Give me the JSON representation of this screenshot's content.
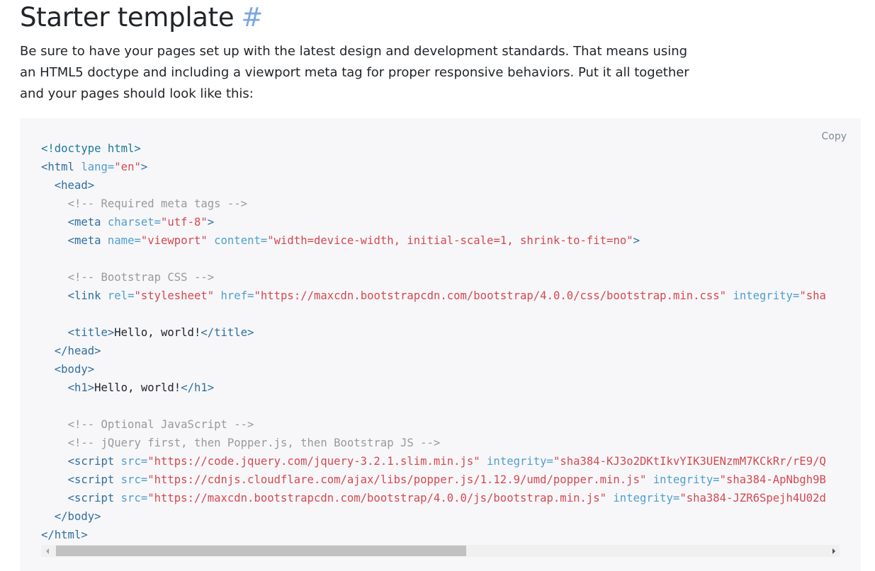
{
  "section": {
    "title": "Starter template",
    "anchor": "#",
    "lead": "Be sure to have your pages set up with the latest design and development standards. That means using an HTML5 doctype and including a viewport meta tag for proper responsive behaviors. Put it all together and your pages should look like this:"
  },
  "code_block": {
    "copy_label": "Copy",
    "lines": [
      [
        {
          "t": "dt",
          "s": "<!doctype html>"
        }
      ],
      [
        {
          "t": "tag",
          "s": "<html "
        },
        {
          "t": "attr",
          "s": "lang="
        },
        {
          "t": "str",
          "s": "\"en\""
        },
        {
          "t": "tag",
          "s": ">"
        }
      ],
      [
        {
          "t": "txt",
          "s": "  "
        },
        {
          "t": "tag",
          "s": "<head>"
        }
      ],
      [
        {
          "t": "txt",
          "s": "    "
        },
        {
          "t": "com",
          "s": "<!-- Required meta tags -->"
        }
      ],
      [
        {
          "t": "txt",
          "s": "    "
        },
        {
          "t": "tag",
          "s": "<meta "
        },
        {
          "t": "attr",
          "s": "charset="
        },
        {
          "t": "str",
          "s": "\"utf-8\""
        },
        {
          "t": "tag",
          "s": ">"
        }
      ],
      [
        {
          "t": "txt",
          "s": "    "
        },
        {
          "t": "tag",
          "s": "<meta "
        },
        {
          "t": "attr",
          "s": "name="
        },
        {
          "t": "str",
          "s": "\"viewport\""
        },
        {
          "t": "txt",
          "s": " "
        },
        {
          "t": "attr",
          "s": "content="
        },
        {
          "t": "str",
          "s": "\"width=device-width, initial-scale=1, shrink-to-fit=no\""
        },
        {
          "t": "tag",
          "s": ">"
        }
      ],
      [],
      [
        {
          "t": "txt",
          "s": "    "
        },
        {
          "t": "com",
          "s": "<!-- Bootstrap CSS -->"
        }
      ],
      [
        {
          "t": "txt",
          "s": "    "
        },
        {
          "t": "tag",
          "s": "<link "
        },
        {
          "t": "attr",
          "s": "rel="
        },
        {
          "t": "str",
          "s": "\"stylesheet\""
        },
        {
          "t": "txt",
          "s": " "
        },
        {
          "t": "attr",
          "s": "href="
        },
        {
          "t": "str",
          "s": "\"https://maxcdn.bootstrapcdn.com/bootstrap/4.0.0/css/bootstrap.min.css\""
        },
        {
          "t": "txt",
          "s": " "
        },
        {
          "t": "attr",
          "s": "integrity="
        },
        {
          "t": "str",
          "s": "\"sha"
        }
      ],
      [],
      [
        {
          "t": "txt",
          "s": "    "
        },
        {
          "t": "tag",
          "s": "<title>"
        },
        {
          "t": "txt",
          "s": "Hello, world!"
        },
        {
          "t": "tag",
          "s": "</title>"
        }
      ],
      [
        {
          "t": "txt",
          "s": "  "
        },
        {
          "t": "tag",
          "s": "</head>"
        }
      ],
      [
        {
          "t": "txt",
          "s": "  "
        },
        {
          "t": "tag",
          "s": "<body>"
        }
      ],
      [
        {
          "t": "txt",
          "s": "    "
        },
        {
          "t": "tag",
          "s": "<h1>"
        },
        {
          "t": "txt",
          "s": "Hello, world!"
        },
        {
          "t": "tag",
          "s": "</h1>"
        }
      ],
      [],
      [
        {
          "t": "txt",
          "s": "    "
        },
        {
          "t": "com",
          "s": "<!-- Optional JavaScript -->"
        }
      ],
      [
        {
          "t": "txt",
          "s": "    "
        },
        {
          "t": "com",
          "s": "<!-- jQuery first, then Popper.js, then Bootstrap JS -->"
        }
      ],
      [
        {
          "t": "txt",
          "s": "    "
        },
        {
          "t": "tag",
          "s": "<script "
        },
        {
          "t": "attr",
          "s": "src="
        },
        {
          "t": "str",
          "s": "\"https://code.jquery.com/jquery-3.2.1.slim.min.js\""
        },
        {
          "t": "txt",
          "s": " "
        },
        {
          "t": "attr",
          "s": "integrity="
        },
        {
          "t": "str",
          "s": "\"sha384-KJ3o2DKtIkvYIK3UENzmM7KCkRr/rE9/Q"
        }
      ],
      [
        {
          "t": "txt",
          "s": "    "
        },
        {
          "t": "tag",
          "s": "<script "
        },
        {
          "t": "attr",
          "s": "src="
        },
        {
          "t": "str",
          "s": "\"https://cdnjs.cloudflare.com/ajax/libs/popper.js/1.12.9/umd/popper.min.js\""
        },
        {
          "t": "txt",
          "s": " "
        },
        {
          "t": "attr",
          "s": "integrity="
        },
        {
          "t": "str",
          "s": "\"sha384-ApNbgh9B"
        }
      ],
      [
        {
          "t": "txt",
          "s": "    "
        },
        {
          "t": "tag",
          "s": "<script "
        },
        {
          "t": "attr",
          "s": "src="
        },
        {
          "t": "str",
          "s": "\"https://maxcdn.bootstrapcdn.com/bootstrap/4.0.0/js/bootstrap.min.js\""
        },
        {
          "t": "txt",
          "s": " "
        },
        {
          "t": "attr",
          "s": "integrity="
        },
        {
          "t": "str",
          "s": "\"sha384-JZR6Spejh4U02d"
        }
      ],
      [
        {
          "t": "txt",
          "s": "  "
        },
        {
          "t": "tag",
          "s": "</body>"
        }
      ],
      [
        {
          "t": "tag",
          "s": "</html>"
        }
      ]
    ]
  },
  "scrollbar": {
    "position_fraction": 0,
    "visible_fraction": 0.53
  }
}
